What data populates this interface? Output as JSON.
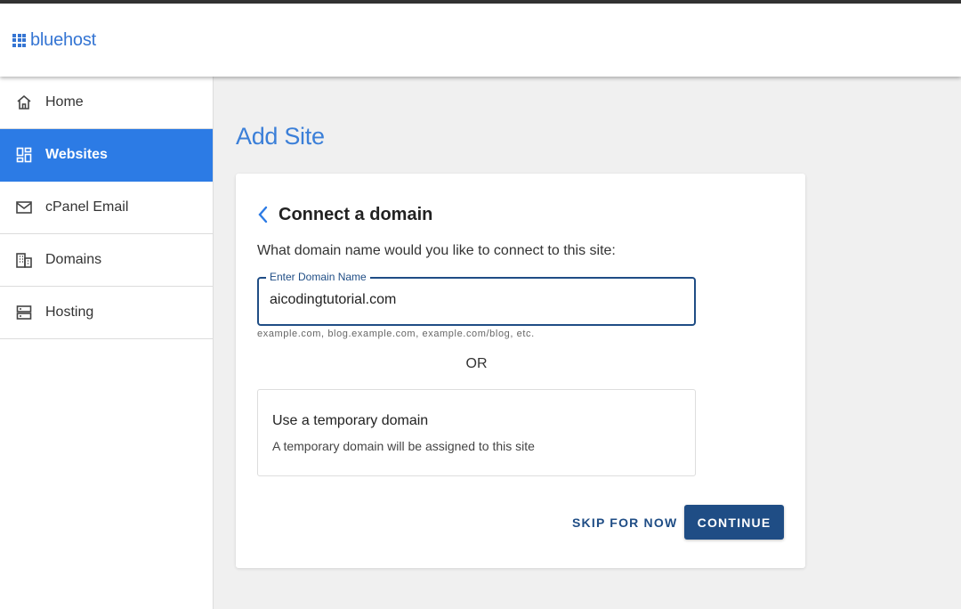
{
  "brand": {
    "name": "bluehost",
    "color": "#3575d3"
  },
  "sidebar": {
    "items": [
      {
        "label": "Home",
        "icon": "home-icon",
        "active": false
      },
      {
        "label": "Websites",
        "icon": "dashboard-icon",
        "active": true
      },
      {
        "label": "cPanel Email",
        "icon": "mail-icon",
        "active": false
      },
      {
        "label": "Domains",
        "icon": "building-icon",
        "active": false
      },
      {
        "label": "Hosting",
        "icon": "server-icon",
        "active": false
      }
    ]
  },
  "page": {
    "title": "Add Site"
  },
  "card": {
    "title": "Connect a domain",
    "question": "What domain name would you like to connect to this site:",
    "domain_field": {
      "label": "Enter Domain Name",
      "value": "aicodingtutorial.com",
      "helper": "example.com, blog.example.com, example.com/blog, etc."
    },
    "or_text": "OR",
    "temporary": {
      "title": "Use a temporary domain",
      "description": "A temporary domain will be assigned to this site"
    },
    "skip_label": "SKIP FOR NOW",
    "continue_label": "CONTINUE"
  },
  "colors": {
    "accent": "#2c7be5",
    "primary": "#1f4d85",
    "title": "#3b7fd8"
  }
}
